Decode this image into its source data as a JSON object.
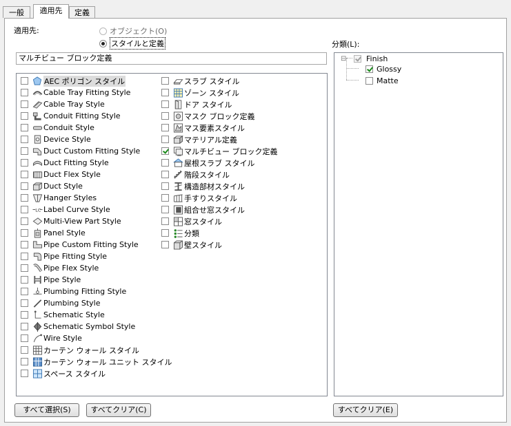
{
  "tabs": [
    {
      "label": "一般",
      "active": false
    },
    {
      "label": "適用先",
      "active": true
    },
    {
      "label": "定義",
      "active": false
    }
  ],
  "apply_to": {
    "label": "適用先:",
    "options": [
      {
        "label": "オブジェクト(O)",
        "selected": false,
        "enabled": false
      },
      {
        "label": "スタイルと定義",
        "selected": true,
        "enabled": true
      }
    ]
  },
  "filter_value": "マルチビュー ブロック定義",
  "classification_label": "分類(L):",
  "style_list_col1": [
    {
      "label": "AEC ポリゴン スタイル",
      "icon": "aec-polygon-icon",
      "checked": false,
      "highlight": true
    },
    {
      "label": "Cable Tray Fitting Style",
      "icon": "cable-tray-fitting-icon",
      "checked": false
    },
    {
      "label": "Cable Tray Style",
      "icon": "cable-tray-icon",
      "checked": false
    },
    {
      "label": "Conduit Fitting Style",
      "icon": "conduit-fitting-icon",
      "checked": false
    },
    {
      "label": "Conduit Style",
      "icon": "conduit-icon",
      "checked": false
    },
    {
      "label": "Device Style",
      "icon": "device-icon",
      "checked": false
    },
    {
      "label": "Duct Custom Fitting Style",
      "icon": "duct-custom-fitting-icon",
      "checked": false
    },
    {
      "label": "Duct Fitting Style",
      "icon": "duct-fitting-icon",
      "checked": false
    },
    {
      "label": "Duct Flex Style",
      "icon": "duct-flex-icon",
      "checked": false
    },
    {
      "label": "Duct Style",
      "icon": "duct-icon",
      "checked": false
    },
    {
      "label": "Hanger Styles",
      "icon": "hanger-icon",
      "checked": false
    },
    {
      "label": "Label Curve Style",
      "icon": "label-curve-icon",
      "checked": false
    },
    {
      "label": "Multi-View Part Style",
      "icon": "multi-view-part-icon",
      "checked": false
    },
    {
      "label": "Panel Style",
      "icon": "panel-icon",
      "checked": false
    },
    {
      "label": "Pipe Custom Fitting Style",
      "icon": "pipe-custom-fitting-icon",
      "checked": false
    },
    {
      "label": "Pipe Fitting Style",
      "icon": "pipe-fitting-icon",
      "checked": false
    },
    {
      "label": "Pipe Flex Style",
      "icon": "pipe-flex-icon",
      "checked": false
    },
    {
      "label": "Pipe Style",
      "icon": "pipe-icon",
      "checked": false
    },
    {
      "label": "Plumbing Fitting Style",
      "icon": "plumbing-fitting-icon",
      "checked": false
    },
    {
      "label": "Plumbing Style",
      "icon": "plumbing-icon",
      "checked": false
    },
    {
      "label": "Schematic Style",
      "icon": "schematic-icon",
      "checked": false
    },
    {
      "label": "Schematic Symbol Style",
      "icon": "schematic-symbol-icon",
      "checked": false
    },
    {
      "label": "Wire Style",
      "icon": "wire-icon",
      "checked": false
    },
    {
      "label": "カーテン ウォール スタイル",
      "icon": "curtain-wall-icon",
      "checked": false
    },
    {
      "label": "カーテン ウォール ユニット スタイル",
      "icon": "curtain-wall-unit-icon",
      "checked": false
    },
    {
      "label": "スペース スタイル",
      "icon": "space-icon",
      "checked": false
    }
  ],
  "style_list_col2": [
    {
      "label": "スラブ スタイル",
      "icon": "slab-icon",
      "checked": false
    },
    {
      "label": "ゾーン スタイル",
      "icon": "zone-icon",
      "checked": false
    },
    {
      "label": "ドア スタイル",
      "icon": "door-icon",
      "checked": false
    },
    {
      "label": "マスク ブロック定義",
      "icon": "mask-block-icon",
      "checked": false
    },
    {
      "label": "マス要素スタイル",
      "icon": "mass-element-icon",
      "checked": false
    },
    {
      "label": "マテリアル定義",
      "icon": "material-icon",
      "checked": false
    },
    {
      "label": "マルチビュー ブロック定義",
      "icon": "multi-view-block-icon",
      "checked": true
    },
    {
      "label": "屋根スラブ スタイル",
      "icon": "roof-slab-icon",
      "checked": false
    },
    {
      "label": "階段スタイル",
      "icon": "stair-icon",
      "checked": false
    },
    {
      "label": "構造部材スタイル",
      "icon": "structural-member-icon",
      "checked": false
    },
    {
      "label": "手すりスタイル",
      "icon": "railing-icon",
      "checked": false
    },
    {
      "label": "組合せ窓スタイル",
      "icon": "window-assembly-icon",
      "checked": false
    },
    {
      "label": "窓スタイル",
      "icon": "window-icon",
      "checked": false
    },
    {
      "label": "分類",
      "icon": "classification-icon",
      "checked": false
    },
    {
      "label": "壁スタイル",
      "icon": "wall-icon",
      "checked": false
    }
  ],
  "tree": [
    {
      "label": "Finish",
      "checked": true,
      "enabled": false,
      "level": 0,
      "expand": "⊟"
    },
    {
      "label": "Glossy",
      "checked": true,
      "enabled": true,
      "level": 1
    },
    {
      "label": "Matte",
      "checked": false,
      "enabled": true,
      "level": 1
    }
  ],
  "buttons": {
    "select_all": "すべて選択(S)",
    "clear_all": "すべてクリア(C)",
    "clear_all_tree": "すべてクリア(E)"
  }
}
